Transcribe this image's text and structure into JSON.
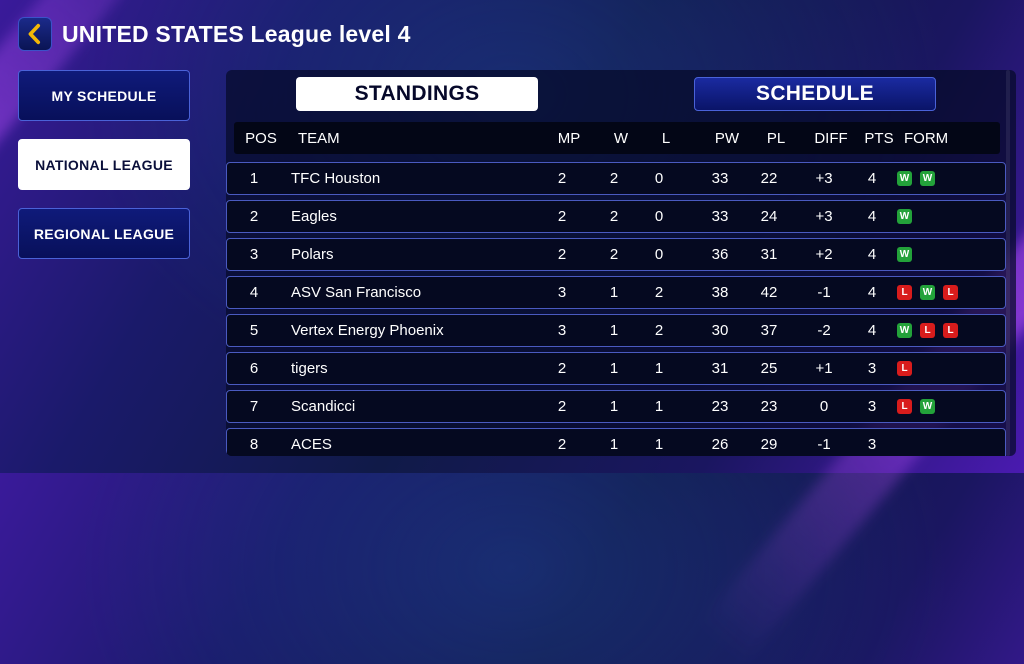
{
  "header": {
    "title": "UNITED STATES League level 4"
  },
  "sidebar": {
    "items": [
      {
        "label": "MY SCHEDULE",
        "active": false
      },
      {
        "label": "NATIONAL LEAGUE",
        "active": true
      },
      {
        "label": "REGIONAL LEAGUE",
        "active": false
      }
    ]
  },
  "tabs": [
    {
      "label": "STANDINGS",
      "active": true
    },
    {
      "label": "SCHEDULE",
      "active": false
    }
  ],
  "table": {
    "columns": [
      "POS",
      "TEAM",
      "MP",
      "W",
      "L",
      "PW",
      "PL",
      "DIFF",
      "PTS",
      "FORM"
    ],
    "rows": [
      {
        "pos": "1",
        "team": "TFC Houston",
        "mp": "2",
        "w": "2",
        "l": "0",
        "pw": "33",
        "pl": "22",
        "diff": "+3",
        "pts": "4",
        "form": [
          "W",
          "W"
        ]
      },
      {
        "pos": "2",
        "team": "Eagles",
        "mp": "2",
        "w": "2",
        "l": "0",
        "pw": "33",
        "pl": "24",
        "diff": "+3",
        "pts": "4",
        "form": [
          "W"
        ]
      },
      {
        "pos": "3",
        "team": "Polars",
        "mp": "2",
        "w": "2",
        "l": "0",
        "pw": "36",
        "pl": "31",
        "diff": "+2",
        "pts": "4",
        "form": [
          "W"
        ]
      },
      {
        "pos": "4",
        "team": "ASV San Francisco",
        "mp": "3",
        "w": "1",
        "l": "2",
        "pw": "38",
        "pl": "42",
        "diff": "-1",
        "pts": "4",
        "form": [
          "L",
          "W",
          "L"
        ]
      },
      {
        "pos": "5",
        "team": "Vertex Energy Phoenix",
        "mp": "3",
        "w": "1",
        "l": "2",
        "pw": "30",
        "pl": "37",
        "diff": "-2",
        "pts": "4",
        "form": [
          "W",
          "L",
          "L"
        ]
      },
      {
        "pos": "6",
        "team": "tigers",
        "mp": "2",
        "w": "1",
        "l": "1",
        "pw": "31",
        "pl": "25",
        "diff": "+1",
        "pts": "3",
        "form": [
          "L"
        ]
      },
      {
        "pos": "7",
        "team": "Scandicci",
        "mp": "2",
        "w": "1",
        "l": "1",
        "pw": "23",
        "pl": "23",
        "diff": "0",
        "pts": "3",
        "form": [
          "L",
          "W"
        ]
      },
      {
        "pos": "8",
        "team": "ACES",
        "mp": "2",
        "w": "1",
        "l": "1",
        "pw": "26",
        "pl": "29",
        "diff": "-1",
        "pts": "3",
        "form": []
      }
    ]
  },
  "colors": {
    "win": "#23a23a",
    "loss": "#d81c1c",
    "accent": "#f2b707",
    "panel": "#050920"
  },
  "icons": {
    "back": "chevron-left-icon"
  }
}
